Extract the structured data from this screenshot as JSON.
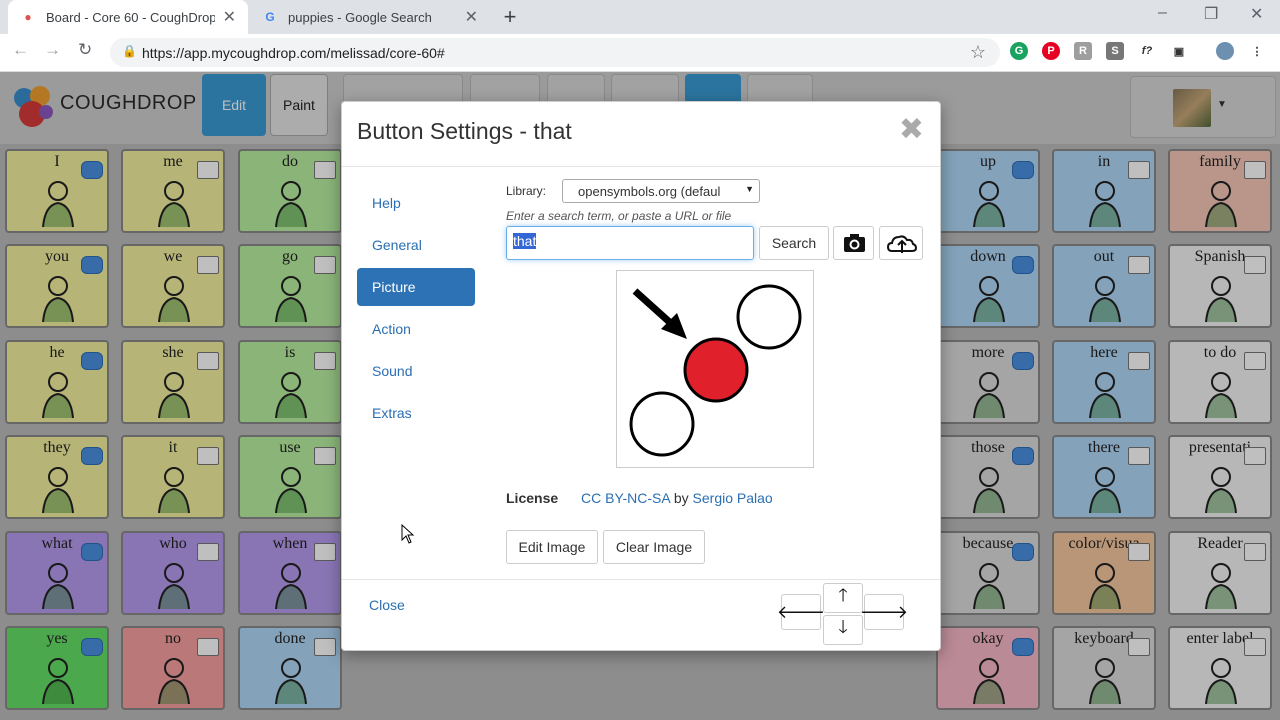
{
  "browser": {
    "tabs": [
      {
        "title": "Board - Core 60 - CoughDrop",
        "active": true
      },
      {
        "title": "puppies - Google Search",
        "active": false
      }
    ],
    "url": "https://app.mycoughdrop.com/melissad/core-60#",
    "icons": [
      "back-icon",
      "forward-icon",
      "reload-icon",
      "lock-icon",
      "star-icon",
      "minimize-icon",
      "restore-icon",
      "close-icon",
      "new-tab-icon"
    ]
  },
  "app": {
    "brand": "COUGHDROP",
    "edit_label": "Edit",
    "paint_label": "Paint"
  },
  "board": {
    "cells": [
      {
        "label": "I",
        "color": "#f4f0a0"
      },
      {
        "label": "me",
        "color": "#f4f0a0"
      },
      {
        "label": "do",
        "color": "#b9f0a0"
      },
      {
        "label": "up",
        "color": "#b0d8f8"
      },
      {
        "label": "in",
        "color": "#b0d8f8"
      },
      {
        "label": "family",
        "color": "#f8c8b8"
      },
      {
        "label": "you",
        "color": "#f4f0a0"
      },
      {
        "label": "we",
        "color": "#f4f0a0"
      },
      {
        "label": "go",
        "color": "#b9f0a0"
      },
      {
        "label": "down",
        "color": "#b0d8f8"
      },
      {
        "label": "out",
        "color": "#b0d8f8"
      },
      {
        "label": "Spanish",
        "color": "#f4f4f4"
      },
      {
        "label": "he",
        "color": "#f4f0a0"
      },
      {
        "label": "she",
        "color": "#f4f0a0"
      },
      {
        "label": "is",
        "color": "#b9f0a0"
      },
      {
        "label": "more",
        "color": "#dddddd"
      },
      {
        "label": "here",
        "color": "#b0d8f8"
      },
      {
        "label": "to do",
        "color": "#f4f4f4"
      },
      {
        "label": "they",
        "color": "#f4f0a0"
      },
      {
        "label": "it",
        "color": "#f4f0a0"
      },
      {
        "label": "use",
        "color": "#b9f0a0"
      },
      {
        "label": "those",
        "color": "#dddddd"
      },
      {
        "label": "there",
        "color": "#b0d8f8"
      },
      {
        "label": "presentati",
        "color": "#f4f4f4"
      },
      {
        "label": "what",
        "color": "#b79cf0"
      },
      {
        "label": "who",
        "color": "#b79cf0"
      },
      {
        "label": "when",
        "color": "#b79cf0"
      },
      {
        "label": "because",
        "color": "#dddddd"
      },
      {
        "label": "color/visua",
        "color": "#f8c8a0"
      },
      {
        "label": "Reader",
        "color": "#f4f4f4"
      },
      {
        "label": "yes",
        "color": "#66e066"
      },
      {
        "label": "no",
        "color": "#f8a0a0"
      },
      {
        "label": "done",
        "color": "#b0d8f8"
      },
      {
        "label": "okay",
        "color": "#f8b8c8"
      },
      {
        "label": "keyboard",
        "color": "#dddddd"
      },
      {
        "label": "enter label",
        "color": "#f4f4f4"
      }
    ]
  },
  "modal": {
    "title": "Button Settings - that",
    "nav": [
      "Help",
      "General",
      "Picture",
      "Action",
      "Sound",
      "Extras"
    ],
    "active_nav": "Picture",
    "library_label": "Library:",
    "library_value": "opensymbols.org (defaul",
    "search_hint": "Enter a search term, or paste a URL or file",
    "search_value": "that",
    "search_button": "Search",
    "license_label": "License",
    "license_name": "CC BY-NC-SA",
    "license_by": "by",
    "license_author": "Sergio Palao",
    "edit_image": "Edit Image",
    "clear_image": "Clear Image",
    "close_label": "Close",
    "arrows": {
      "up": "🡑",
      "down": "🡓",
      "left": "🡐",
      "right": "🡒"
    }
  }
}
